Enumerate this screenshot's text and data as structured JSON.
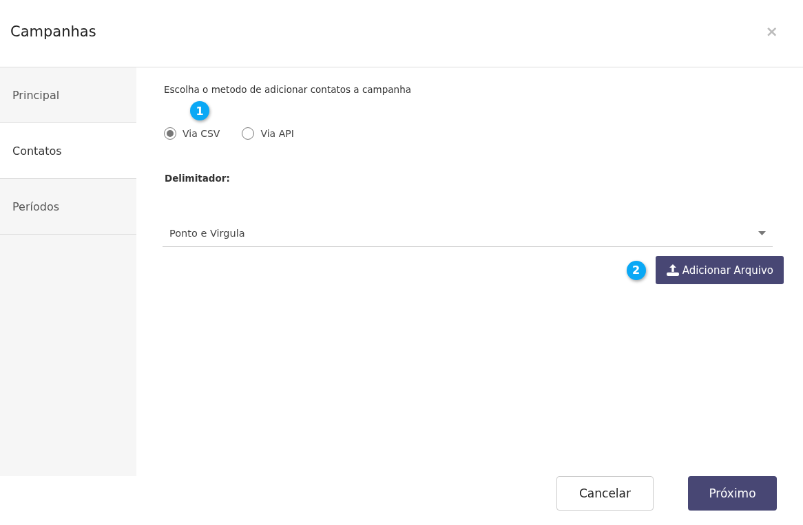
{
  "window": {
    "title": "Campanhas",
    "close": "×"
  },
  "sidebar": {
    "items": [
      {
        "label": "Principal",
        "selected": false
      },
      {
        "label": "Contatos",
        "selected": true
      },
      {
        "label": "Períodos",
        "selected": false
      }
    ]
  },
  "content": {
    "instruction": "Escolha o metodo de adicionar contatos a campanha",
    "marker_1": "1",
    "method_options": [
      {
        "label": "Via CSV",
        "selected": true
      },
      {
        "label": "Via API",
        "selected": false
      }
    ],
    "delimiter_label": "Delimitador:",
    "delimiter_value": "Ponto e Virgula",
    "marker_2": "2",
    "add_file_button": "Adicionar Arquivo"
  },
  "footer": {
    "buttons": [
      {
        "label": "Cancelar",
        "kind": "secondary"
      },
      {
        "label": "Próximo",
        "kind": "primary"
      }
    ]
  }
}
